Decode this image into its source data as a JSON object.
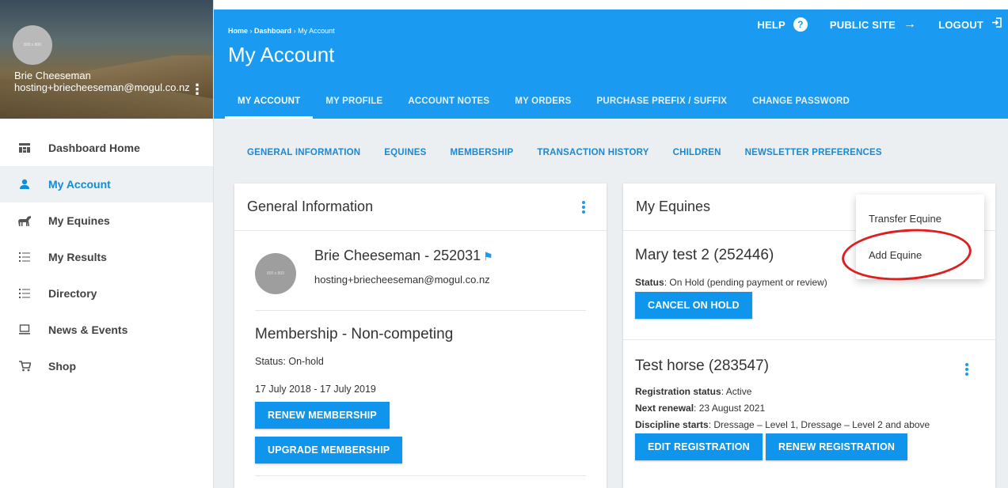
{
  "sidebar": {
    "user_name": "Brie Cheeseman",
    "user_email": "hosting+briecheeseman@mogul.co.nz",
    "avatar_text": "800 x 800",
    "items": [
      {
        "label": "Dashboard Home",
        "icon": "dashboard-icon"
      },
      {
        "label": "My Account",
        "icon": "person-icon"
      },
      {
        "label": "My Equines",
        "icon": "horse-icon"
      },
      {
        "label": "My Results",
        "icon": "list-icon"
      },
      {
        "label": "Directory",
        "icon": "list-icon"
      },
      {
        "label": "News & Events",
        "icon": "laptop-icon"
      },
      {
        "label": "Shop",
        "icon": "cart-icon"
      }
    ]
  },
  "header": {
    "crumb_home": "Home",
    "crumb_sep": "›",
    "crumb_dashboard": "Dashboard",
    "crumb_current": "My Account",
    "title": "My Account",
    "help": "HELP",
    "public_site": "PUBLIC SITE",
    "logout": "LOGOUT",
    "tabs": [
      "MY ACCOUNT",
      "MY PROFILE",
      "ACCOUNT NOTES",
      "MY ORDERS",
      "PURCHASE PREFIX / SUFFIX",
      "CHANGE PASSWORD"
    ]
  },
  "subnav": [
    "GENERAL INFORMATION",
    "EQUINES",
    "MEMBERSHIP",
    "TRANSACTION HISTORY",
    "CHILDREN",
    "NEWSLETTER PREFERENCES"
  ],
  "general": {
    "title": "General Information",
    "user_name": "Brie Cheeseman - 252031",
    "user_email": "hosting+briecheeseman@mogul.co.nz",
    "avatar_text": "800 x 800",
    "membership_title": "Membership - Non-competing",
    "membership_status": "Status: On-hold",
    "membership_dates": "17 July 2018 - 17 July 2019",
    "renew_btn": "RENEW MEMBERSHIP",
    "upgrade_btn": "UPGRADE MEMBERSHIP"
  },
  "equines": {
    "title": "My Equines",
    "eq1": {
      "name": "Mary test 2 (252446)",
      "status_label": "Status",
      "status_value": ": On Hold (pending payment or review)",
      "cancel_btn": "CANCEL ON HOLD"
    },
    "eq2": {
      "name": "Test horse (283547)",
      "reg_label": "Registration status",
      "reg_value": ": Active",
      "renewal_label": "Next renewal",
      "renewal_value": ": 23 August 2021",
      "disc_label": "Discipline starts",
      "disc_value": ": Dressage – Level 1, Dressage – Level 2 and above",
      "edit_btn": "EDIT REGISTRATION",
      "renew_btn": "RENEW REGISTRATION"
    },
    "menu": [
      "Transfer Equine",
      "Add Equine"
    ]
  },
  "colors": {
    "primary": "#1a9af0",
    "highlight_ring": "#e01e1e"
  }
}
